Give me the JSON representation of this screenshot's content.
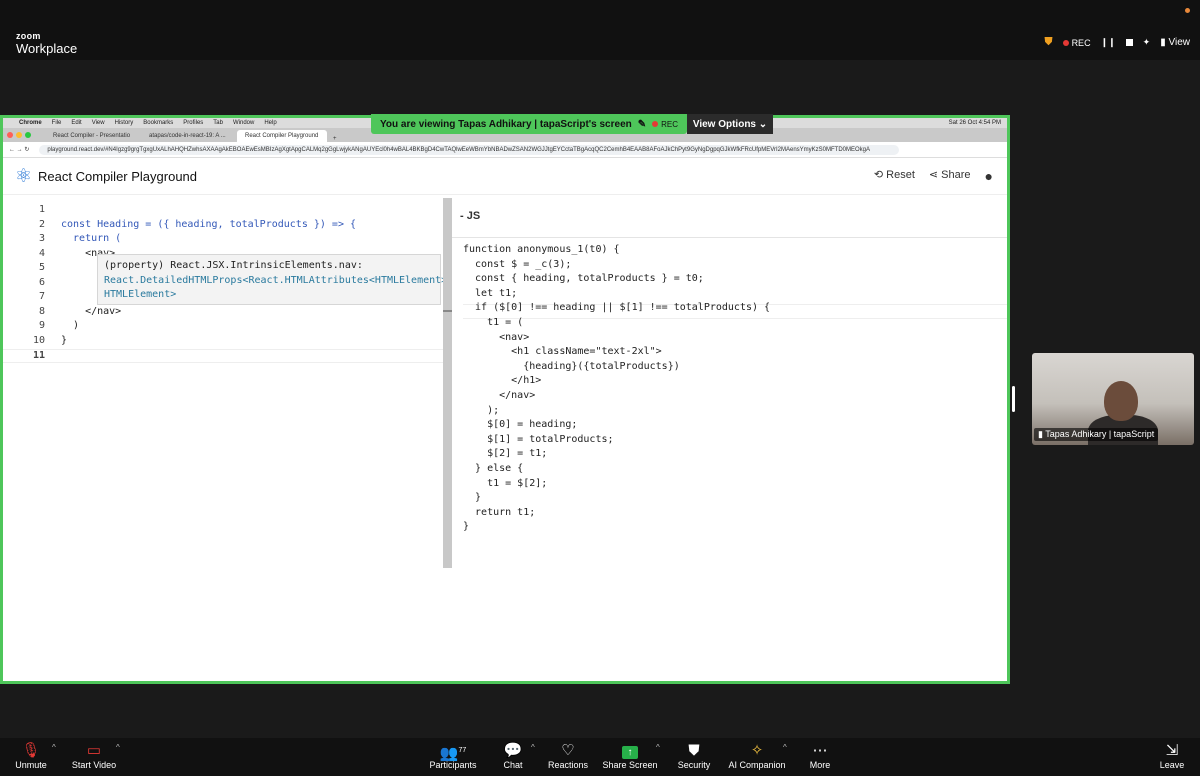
{
  "zoom": {
    "brand_top": "zoom",
    "brand_bottom": "Workplace",
    "rec_label": "REC",
    "view_label": "View"
  },
  "share": {
    "banner_text": "You are viewing  Tapas Adhikary | tapaScript's screen",
    "banner_rec": "REC",
    "view_options": "View Options"
  },
  "browser": {
    "menu": [
      "Chrome",
      "File",
      "Edit",
      "View",
      "History",
      "Bookmarks",
      "Profiles",
      "Tab",
      "Window",
      "Help"
    ],
    "clock": "Sat 26 Oct  4:54 PM",
    "tabs": [
      "React Compiler - Presentatio",
      "atapas/code-in-react-19: A ...",
      "React Compiler Playground"
    ],
    "url": "playground.react.dev/#N4Igzg9grgTgxgUxALhAHQHZwhsAXAAgAkEBOAEwEsMBIzAgXgtApgCALMq2gGgLwjykANgAUYEcl0h4wBAL4BKBgD4CwTAQlwEeWBmYbNBADwZSAN2WGJJtgEYCctaTBgAcqQC2CemhB4EAAB8AFoAJkChPyt9GyNgDgpqGJkWfkFRcUfpMEVrI2MAensYmyKzS0MFTD0MEOkgA"
  },
  "playground": {
    "title": "React Compiler Playground",
    "reset": "Reset",
    "share": "Share",
    "output_header": "- JS"
  },
  "tooltip": {
    "line1": "(property) React.JSX.IntrinsicElements.nav:",
    "line2": "React.DetailedHTMLProps<React.HTMLAttributes<HTMLElement>,",
    "line3": "HTMLElement>"
  },
  "editor": {
    "lines": [
      {
        "n": "1",
        "code": ""
      },
      {
        "n": "2",
        "code": "const Heading = ({ heading, totalProducts }) => {"
      },
      {
        "n": "3",
        "code": "  return ("
      },
      {
        "n": "4",
        "code": "    <nav>"
      },
      {
        "n": "5",
        "code": ""
      },
      {
        "n": "6",
        "code": ""
      },
      {
        "n": "7",
        "code": ""
      },
      {
        "n": "8",
        "code": "    </nav>"
      },
      {
        "n": "9",
        "code": "  )"
      },
      {
        "n": "10",
        "code": "}"
      },
      {
        "n": "11",
        "code": ""
      }
    ]
  },
  "output": {
    "lines": [
      "function anonymous_1(t0) {",
      "  const $ = _c(3);",
      "  const { heading, totalProducts } = t0;",
      "  let t1;",
      "  if ($[0] !== heading || $[1] !== totalProducts) {",
      "    t1 = (",
      "      <nav>",
      "        <h1 className=\"text-2xl\">",
      "          {heading}({totalProducts})",
      "        </h1>",
      "      </nav>",
      "    );",
      "    $[0] = heading;",
      "    $[1] = totalProducts;",
      "    $[2] = t1;",
      "  } else {",
      "    t1 = $[2];",
      "  }",
      "  return t1;",
      "}"
    ]
  },
  "video": {
    "name": "Tapas Adhikary | tapaScript"
  },
  "toolbar": {
    "unmute": "Unmute",
    "start_video": "Start Video",
    "participants": "Participants",
    "participants_count": "77",
    "chat": "Chat",
    "reactions": "Reactions",
    "share_screen": "Share Screen",
    "security": "Security",
    "ai_companion": "AI Companion",
    "more": "More",
    "leave": "Leave"
  },
  "colors": {
    "share_border": "#4ec65a",
    "react_blue": "#2d7ad6",
    "keyword": "#3358b8",
    "rec_red": "#e53935"
  }
}
